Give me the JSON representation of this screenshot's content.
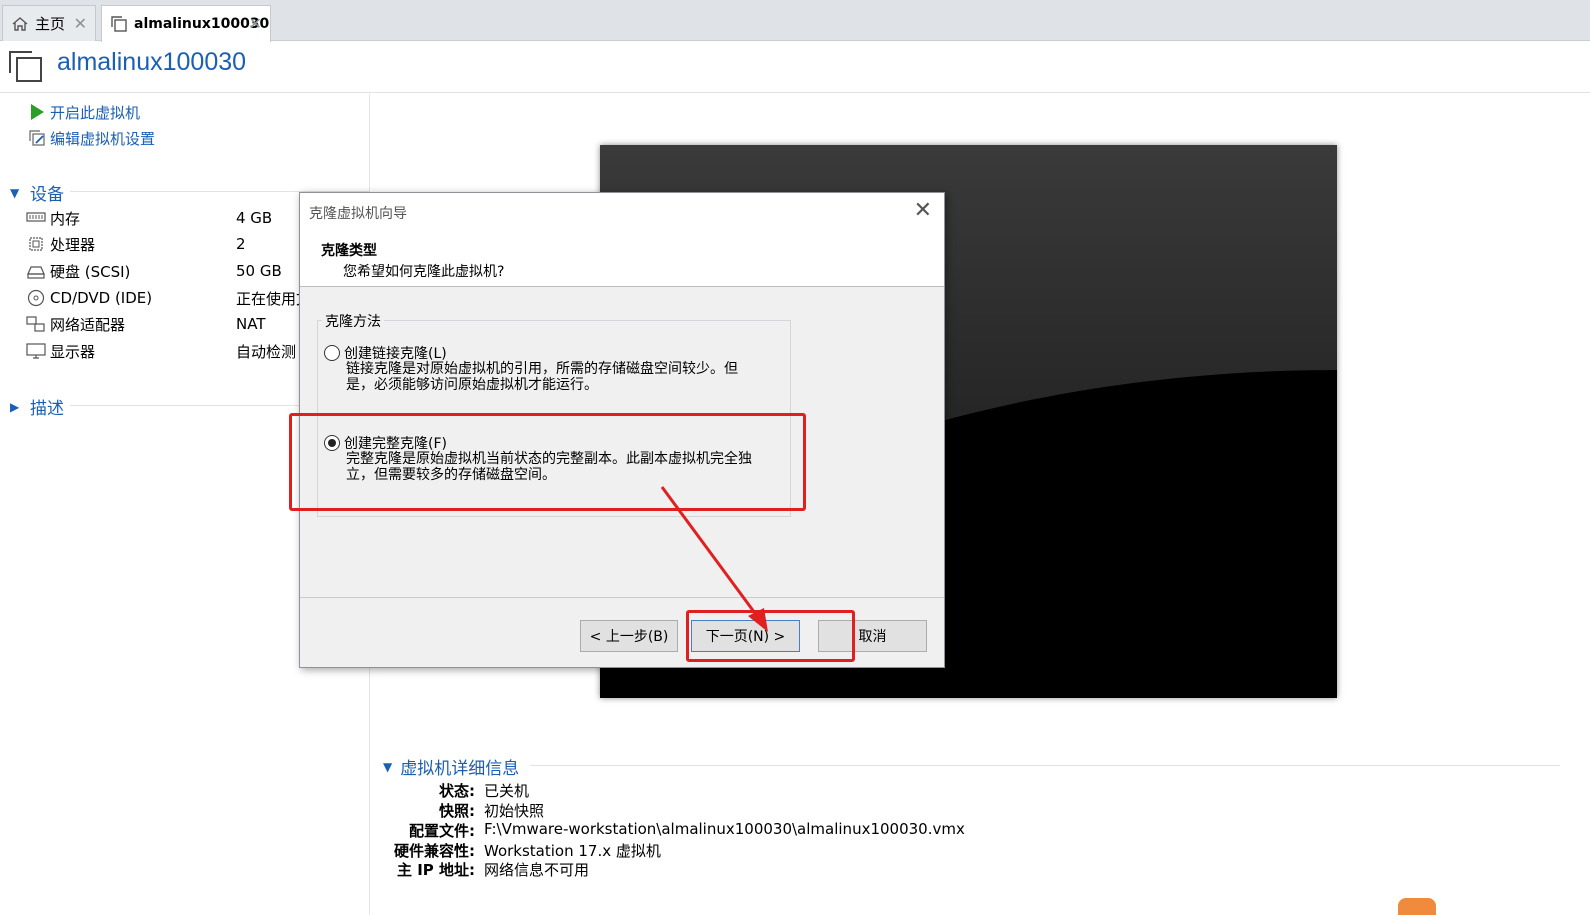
{
  "tabs": [
    {
      "label": "主页",
      "icon": "home-icon"
    },
    {
      "label": "almalinux100030",
      "icon": "vm-icon"
    }
  ],
  "title": "almalinux100030",
  "actions": {
    "power_on": "开启此虚拟机",
    "edit_settings": "编辑虚拟机设置"
  },
  "devices_section": "设备",
  "devices": [
    {
      "name": "内存",
      "value": "4 GB",
      "icon": "memory-icon"
    },
    {
      "name": "处理器",
      "value": "2",
      "icon": "cpu-icon"
    },
    {
      "name": "硬盘 (SCSI)",
      "value": "50 GB",
      "icon": "disk-icon"
    },
    {
      "name": "CD/DVD (IDE)",
      "value": "正在使用文",
      "icon": "cd-icon"
    },
    {
      "name": "网络适配器",
      "value": "NAT",
      "icon": "network-icon"
    },
    {
      "name": "显示器",
      "value": "自动检测",
      "icon": "monitor-icon"
    }
  ],
  "description_section": "描述",
  "details_section": "虚拟机详细信息",
  "details": [
    {
      "label": "状态:",
      "value": "已关机"
    },
    {
      "label": "快照:",
      "value": "初始快照"
    },
    {
      "label": "配置文件:",
      "value": "F:\\Vmware-workstation\\almalinux100030\\almalinux100030.vmx"
    },
    {
      "label": "硬件兼容性:",
      "value": "Workstation 17.x 虚拟机"
    },
    {
      "label": "主 IP 地址:",
      "value": "网络信息不可用"
    }
  ],
  "dialog": {
    "title": "克隆虚拟机向导",
    "heading": "克隆类型",
    "subheading": "您希望如何克隆此虚拟机?",
    "group_label": "克隆方法",
    "option_linked": {
      "label": "创建链接克隆(L)",
      "desc_line1": "链接克隆是对原始虚拟机的引用，所需的存储磁盘空间较少。但",
      "desc_line2": "是，必须能够访问原始虚拟机才能运行。",
      "selected": false
    },
    "option_full": {
      "label": "创建完整克隆(F)",
      "desc_line1": "完整克隆是原始虚拟机当前状态的完整副本。此副本虚拟机完全独",
      "desc_line2": "立，但需要较多的存储磁盘空间。",
      "selected": true
    },
    "back_label": "< 上一步(B)",
    "next_label": "下一页(N) >",
    "cancel_label": "取消"
  },
  "colors": {
    "accent": "#1b5fb5",
    "annotation": "#e02020",
    "play": "#2aa02a"
  }
}
